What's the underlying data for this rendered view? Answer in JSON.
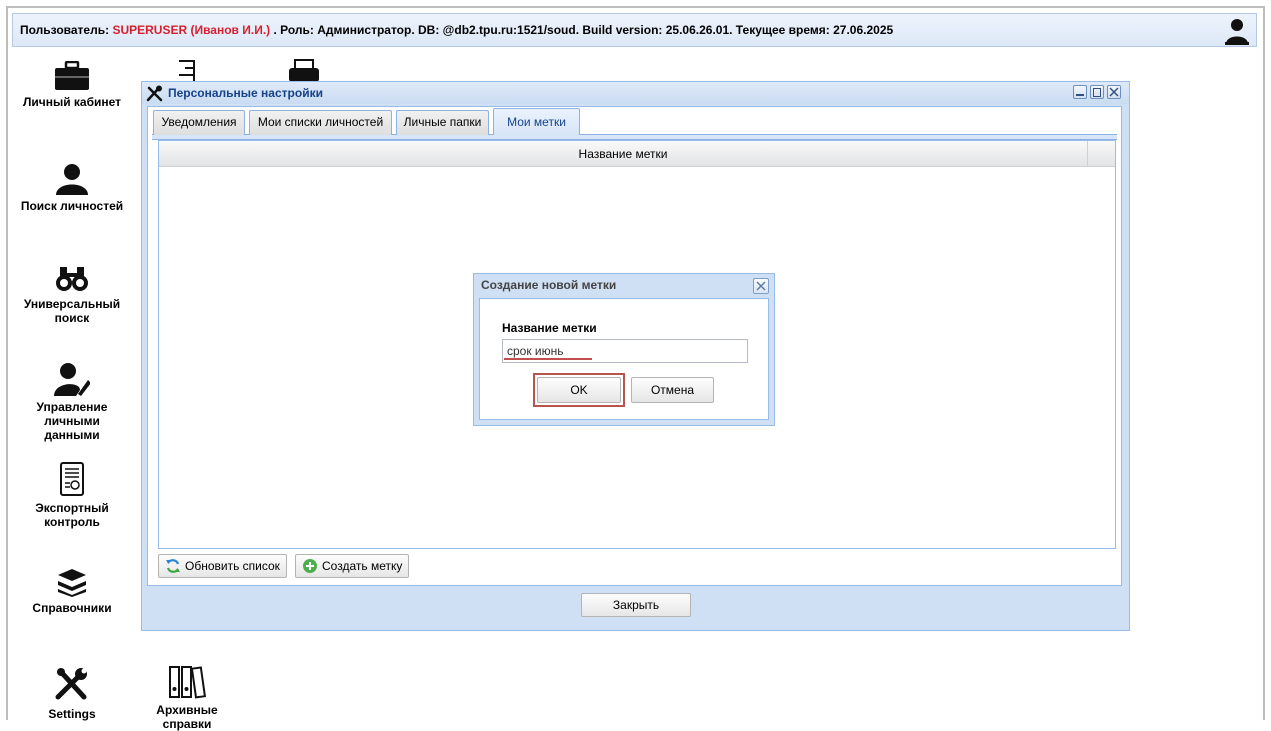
{
  "topbar": {
    "user_prefix": "Пользователь: ",
    "user_name": "SUPERUSER (Иванов И.И.)",
    "info": " . Роль: Администратор. DB: @db2.tpu.ru:1521/soud. Build version: 25.06.26.01. Текущее время: 27.06.2025"
  },
  "sidebar": {
    "items": [
      {
        "label": "Личный кабинет",
        "icon": "briefcase-icon"
      },
      {
        "label": "Поиск личностей",
        "icon": "person-icon"
      },
      {
        "label": "Универсальный поиск",
        "icon": "binoculars-icon"
      },
      {
        "label": "Управление личными данными",
        "icon": "person-edit-icon"
      },
      {
        "label": "Экспортный контроль",
        "icon": "certificate-icon"
      },
      {
        "label": "Справочники",
        "icon": "books-icon"
      },
      {
        "label": "Settings",
        "icon": "tools-icon"
      },
      {
        "label": "Архивные справки",
        "icon": "archive-binders-icon"
      }
    ]
  },
  "window": {
    "title": "Персональные настройки",
    "tabs": [
      {
        "label": "Уведомления"
      },
      {
        "label": "Мои списки личностей"
      },
      {
        "label": "Личные папки"
      },
      {
        "label": "Мои метки"
      }
    ],
    "active_tab": "Мои метки",
    "grid": {
      "columns": [
        "Название метки"
      ],
      "rows": []
    },
    "refresh_label": "Обновить список",
    "create_label": "Создать метку",
    "close_label": "Закрыть"
  },
  "dialog": {
    "title": "Создание новой метки",
    "field_label": "Название метки",
    "field_value": "срок июнь",
    "ok_label": "OK",
    "cancel_label": "Отмена"
  },
  "colors": {
    "user_name": "#d7202f",
    "window_border": "#99bbe8",
    "title_text": "#15428b",
    "highlight": "#b85450"
  }
}
